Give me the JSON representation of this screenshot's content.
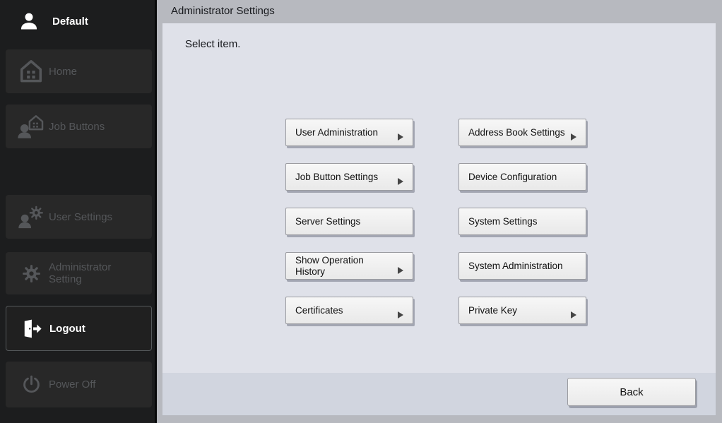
{
  "sidebar": {
    "user": {
      "name": "Default",
      "icon": "user-icon"
    },
    "items": [
      {
        "id": "home",
        "label": "Home",
        "icon": "home-icon",
        "state": "disabled"
      },
      {
        "id": "job-buttons",
        "label": "Job Buttons",
        "icon": "job-buttons-icon",
        "state": "disabled"
      },
      {
        "id": "user-settings",
        "label": "User Settings",
        "icon": "user-settings-icon",
        "state": "disabled"
      },
      {
        "id": "administrator-setting",
        "label": "Administrator Setting",
        "icon": "gear-icon",
        "state": "disabled"
      },
      {
        "id": "logout",
        "label": "Logout",
        "icon": "logout-icon",
        "state": "active"
      },
      {
        "id": "power-off",
        "label": "Power Off",
        "icon": "power-icon",
        "state": "disabled"
      }
    ]
  },
  "header": {
    "title": "Administrator Settings"
  },
  "main": {
    "prompt": "Select item.",
    "buttons": [
      {
        "label": "User Administration",
        "arrow": true
      },
      {
        "label": "Address Book Settings",
        "arrow": true
      },
      {
        "label": "Job Button Settings",
        "arrow": true
      },
      {
        "label": "Device Configuration",
        "arrow": false
      },
      {
        "label": "Server Settings",
        "arrow": false
      },
      {
        "label": "System Settings",
        "arrow": false
      },
      {
        "label": "Show Operation History",
        "arrow": true
      },
      {
        "label": "System Administration",
        "arrow": false
      },
      {
        "label": "Certificates",
        "arrow": true
      },
      {
        "label": "Private Key",
        "arrow": true
      }
    ],
    "back_label": "Back"
  },
  "colors": {
    "sidebar_bg": "#1c1d1e",
    "sidebar_item_bg": "#282828",
    "sidebar_disabled_text": "#55575a",
    "sidebar_active_text": "#ffffff",
    "frame_bg": "#b7b9bf",
    "content_bg": "#dfe1e9",
    "footer_bg": "#d1d5df",
    "button_bg": "#f2f2f2",
    "button_border": "#9b9ca1",
    "button_text": "#111111",
    "arrow_color": "#454545"
  }
}
